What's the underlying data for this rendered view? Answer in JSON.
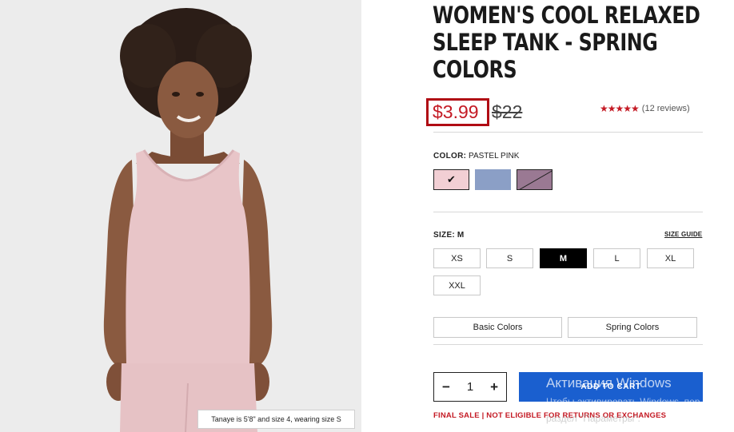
{
  "product": {
    "title": "WOMEN'S COOL RELAXED SLEEP TANK - SPRING COLORS",
    "sale_price": "$3.99",
    "original_price": "$22",
    "rating_stars": "★★★★★",
    "reviews": "(12 reviews)",
    "model_caption": "Tanaye is 5'8\" and size 4, wearing size S"
  },
  "color": {
    "label": "COLOR:",
    "selected": "PASTEL PINK",
    "swatches": [
      {
        "name": "Pastel Pink",
        "hex": "#f2cfd4",
        "selected": true,
        "check": "✔"
      },
      {
        "name": "Periwinkle",
        "hex": "#8b9fc6",
        "selected": false
      },
      {
        "name": "Mauve",
        "hex": "#9a7993",
        "selected": false,
        "unavailable": true
      }
    ]
  },
  "size": {
    "label": "SIZE:",
    "selected": "M",
    "guide_label": "SIZE GUIDE",
    "options": [
      "XS",
      "S",
      "M",
      "L",
      "XL",
      "XXL"
    ]
  },
  "collections": [
    "Basic Colors",
    "Spring Colors"
  ],
  "cart": {
    "quantity": "1",
    "minus": "−",
    "plus": "+",
    "add_label": "ADD TO CART"
  },
  "final_sale": "FINAL SALE | NOT ELIGIBLE FOR RETURNS OR EXCHANGES",
  "watermark": {
    "line1": "Активация Windows",
    "line2": "Чтобы активировать Windows, пер",
    "line3": "раздел \"Параметры\"."
  },
  "colors": {
    "accent_red": "#c41a24",
    "cart_blue": "#1a5fcf",
    "photo_bg": "#ececec"
  }
}
